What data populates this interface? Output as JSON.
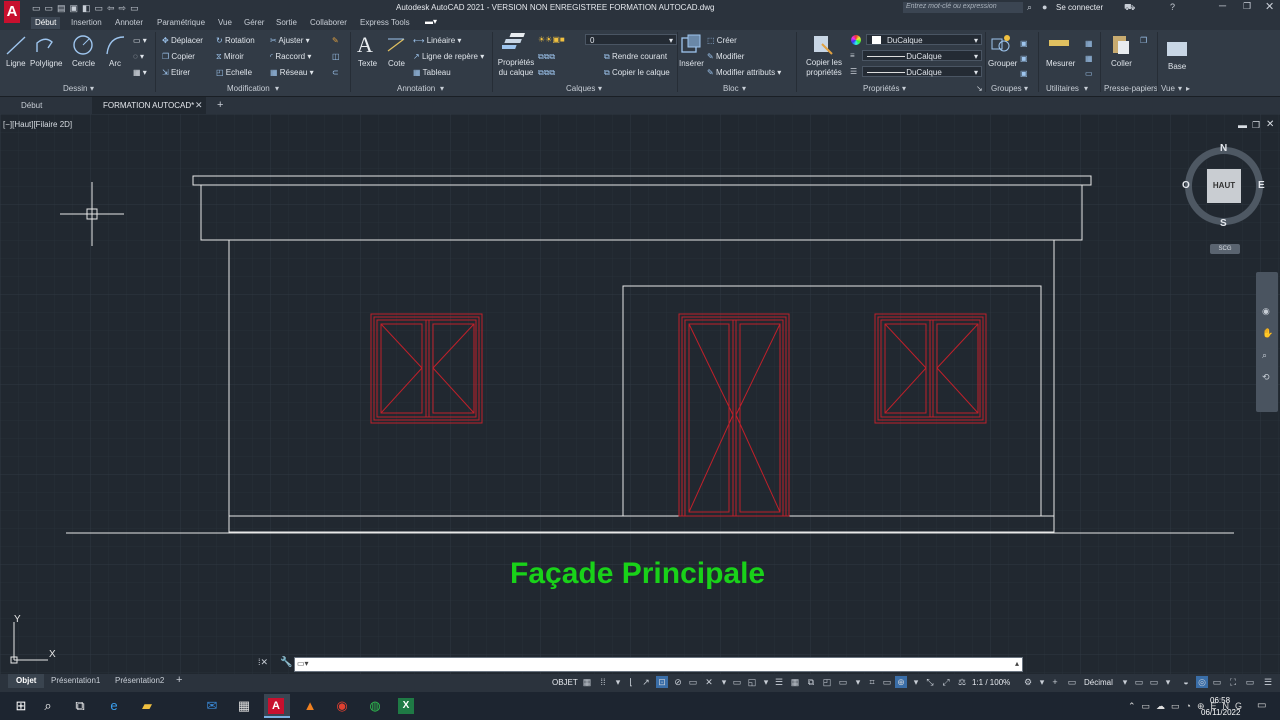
{
  "window": {
    "title": "Autodesk AutoCAD 2021 - VERSION NON ENREGISTREE    FORMATION AUTOCAD.dwg",
    "search_placeholder": "Entrez mot-clé ou expression",
    "sign_in": "Se connecter"
  },
  "ribbon_tabs": [
    "Début",
    "Insertion",
    "Annoter",
    "Paramétrique",
    "Vue",
    "Gérer",
    "Sortie",
    "Collaborer",
    "Express Tools"
  ],
  "dessin": {
    "label": "Dessin",
    "tools": [
      "Ligne",
      "Polyligne",
      "Cercle",
      "Arc"
    ]
  },
  "modification": {
    "label": "Modification",
    "col1": [
      "Déplacer",
      "Copier",
      "Etirer"
    ],
    "col2": [
      "Rotation",
      "Miroir",
      "Echelle"
    ],
    "col3": [
      "Ajuster",
      "Raccord",
      "Réseau"
    ]
  },
  "annotation": {
    "label": "Annotation",
    "big": [
      "Texte",
      "Cote"
    ],
    "small": [
      "Linéaire",
      "Ligne de repère",
      "Tableau"
    ]
  },
  "calques": {
    "label": "Calques",
    "big": "Propriétés du calque",
    "layer_value": "0",
    "actions": [
      "Rendre courant",
      "Copier le calque"
    ]
  },
  "bloc": {
    "label": "Bloc",
    "big": "Insérer",
    "actions": [
      "Créer",
      "Modifier",
      "Modifier attributs"
    ]
  },
  "proprietes": {
    "label": "Propriétés",
    "big": "Copier les propriétés",
    "color": "DuCalque",
    "linetype": "DuCalque",
    "lineweight": "DuCalque"
  },
  "groupes": {
    "label": "Groupes",
    "big": "Grouper"
  },
  "utilitaires": {
    "label": "Utilitaires",
    "big": "Mesurer"
  },
  "presse": {
    "label": "Presse-papiers",
    "big": "Coller"
  },
  "vue": {
    "label": "Vue",
    "big": "Base"
  },
  "doc_tabs": [
    "Début",
    "FORMATION AUTOCAD*"
  ],
  "viewport": {
    "label": "[−][Haut][Filaire 2D]",
    "drawing_title": "Façade Principale",
    "viewcube": {
      "face": "HAUT",
      "n": "N",
      "s": "S",
      "e": "E",
      "w": "O",
      "ucs": "SCG"
    },
    "axis_x": "X",
    "axis_y": "Y"
  },
  "layout_tabs": [
    "Objet",
    "Présentation1",
    "Présentation2"
  ],
  "status": {
    "mode": "OBJET",
    "scale": "1:1 / 100%",
    "units": "Décimal"
  },
  "taskbar": {
    "time": "06:58",
    "date": "06/11/2022"
  },
  "colors": {
    "accent_title": "#19d219",
    "window_red": "#c0202a",
    "lines": "#e8e8e8"
  }
}
